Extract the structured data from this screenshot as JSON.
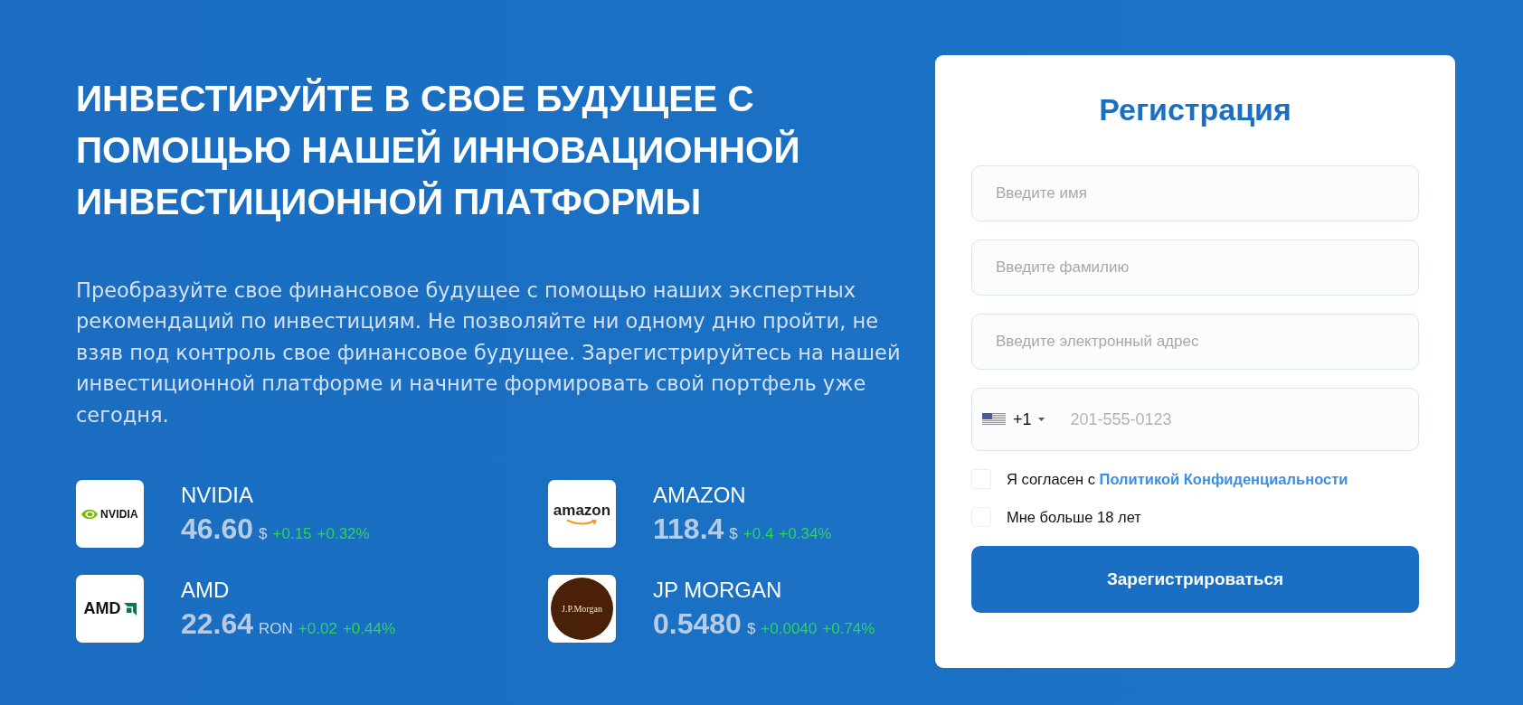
{
  "hero": {
    "heading": "ИНВЕСТИРУЙТЕ В СВОЕ БУДУЩЕЕ С ПОМОЩЬЮ НАШЕЙ ИННОВАЦИОННОЙ ИНВЕСТИЦИОННОЙ ПЛАТФОРМЫ",
    "description": "Преобразуйте свое финансовое будущее с помощью наших экспертных рекомендаций по инвестициям. Не позволяйте ни одному дню пройти, не взяв под контроль свое финансовое будущее. Зарегистрируйтесь на нашей инвестиционной платформе и начните формировать свой портфель уже сегодня."
  },
  "stocks": [
    {
      "name": "NVIDIA",
      "logo": {
        "kind": "eye",
        "text": "NVIDIA"
      },
      "price": "46.60",
      "currency": "$",
      "change": "+0.15",
      "change_percent": "+0.32%"
    },
    {
      "name": "AMAZON",
      "logo": {
        "kind": "smile",
        "text": "amazon"
      },
      "price": "118.4",
      "currency": "$",
      "change": "+0.4",
      "change_percent": "+0.34%"
    },
    {
      "name": "AMD",
      "logo": {
        "kind": "arrow",
        "text": "AMD"
      },
      "price": "22.64",
      "currency": "RON",
      "change": "+0.02",
      "change_percent": "+0.44%"
    },
    {
      "name": "JP MORGAN",
      "logo": {
        "kind": "seal",
        "text": "J.P.Morgan"
      },
      "price": "0.5480",
      "currency": "$",
      "change": "+0.0040",
      "change_percent": "+0.74%"
    }
  ],
  "form": {
    "title": "Регистрация",
    "fields": [
      {
        "placeholder": "Введите имя"
      },
      {
        "placeholder": "Введите фамилию"
      },
      {
        "placeholder": "Введите электронный адрес"
      }
    ],
    "phone": {
      "dial_code": "+1",
      "placeholder": "201-555-0123"
    },
    "checkboxes": [
      {
        "label": "Я согласен с",
        "link": "Политикой Конфиденциальности",
        "checked": false
      },
      {
        "label": "Мне больше 18 лет",
        "checked": false
      }
    ],
    "submit": "Зарегистрироваться"
  }
}
